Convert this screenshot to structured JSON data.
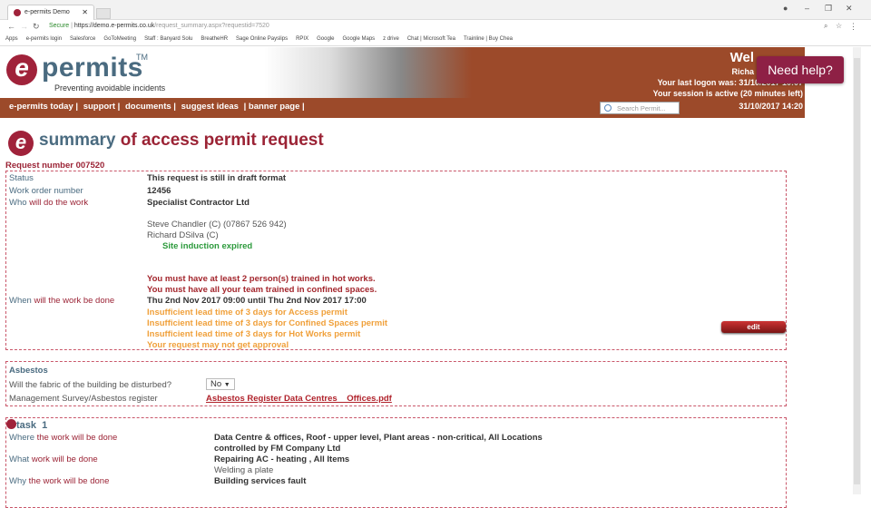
{
  "browser": {
    "tab_title": "e-permits Demo",
    "url_secure": "Secure",
    "url_host": "https://demo.e-permits.co.uk",
    "url_path": "/request_summary.aspx?requestid=7520",
    "bookmarks": [
      "Apps",
      "e-permits login",
      "Salesforce",
      "GoToMeeting",
      "Staff : Banyard Solu",
      "BreatheHR",
      "Sage Online Payslips",
      "RPIX",
      "Google",
      "Google Maps",
      "z drive",
      "Chat | Microsoft Tea",
      "Trainline | Buy Chea"
    ]
  },
  "header": {
    "logo_text": "permits",
    "logo_tm": "TM",
    "tagline": "Preventing avoidable incidents",
    "welcome": "Wel",
    "user": "Richa",
    "last_logon": "Your last logon was: 31/10/2017 10:07",
    "session": "Your session is active  (20 minutes left)",
    "datetime": "31/10/2017 14:20",
    "search_placeholder": "Search Permit...",
    "nav": [
      "e-permits today |",
      "support |",
      "documents |",
      "suggest ideas",
      "| banner page |"
    ]
  },
  "help_button": "Need help?",
  "page": {
    "title_a": "summary",
    "title_b": "of access permit request",
    "request_number": "Request number 007520"
  },
  "summary": {
    "status_label": "Status",
    "status": "This request is still in draft format",
    "wo_label": "Work order number",
    "wo": "12456",
    "who_label_a": "Who",
    "who_label_b": "will do the work",
    "contractor": "Specialist Contractor Ltd",
    "person1": "Steve Chandler (C) (07867 526 942)",
    "person2": "Richard DSilva (C)",
    "induction": "Site induction expired",
    "warn1": "You must have at least 2 person(s) trained in hot works.",
    "warn2": "You must have all your team trained in confined spaces.",
    "when_label_a": "When",
    "when_label_b": "will the work be done",
    "when": "Thu 2nd Nov 2017 09:00  until  Thu 2nd Nov 2017 17:00",
    "lead1": "Insufficient lead time of 3 days for Access permit",
    "lead2": "Insufficient lead time of 3 days for Confined Spaces permit",
    "lead3": "Insufficient lead time of 3 days for Hot Works permit",
    "lead4": "Your request may not get approval",
    "edit": "edit"
  },
  "asbestos": {
    "title": "Asbestos",
    "q1": "Will the fabric of the building be disturbed?",
    "a1": "No",
    "q2": "Management Survey/Asbestos register",
    "file": "Asbestos Register Data Centres    Offices.pdf"
  },
  "task": {
    "title": "task",
    "number": "1",
    "where_a": "Where",
    "where_b": "the work will be done",
    "where1": "Data Centre & offices, Roof - upper level, Plant areas - non-critical, All Locations",
    "where2": "controlled by FM Company Ltd",
    "what_a": "What",
    "what_b": "work will be done",
    "what1": "Repairing AC - heating , All Items",
    "what2": "Welding a plate",
    "why_a": "Why",
    "why_b": "the work will be done",
    "why": "Building services fault"
  },
  "colors": {
    "brand_brown": "#9c4a2a",
    "brand_maroon": "#a0223a",
    "label_blue": "#4a6b80",
    "warning_red": "#a3252c",
    "warning_orange": "#f0a03a",
    "ok_green": "#2c9a3c"
  }
}
